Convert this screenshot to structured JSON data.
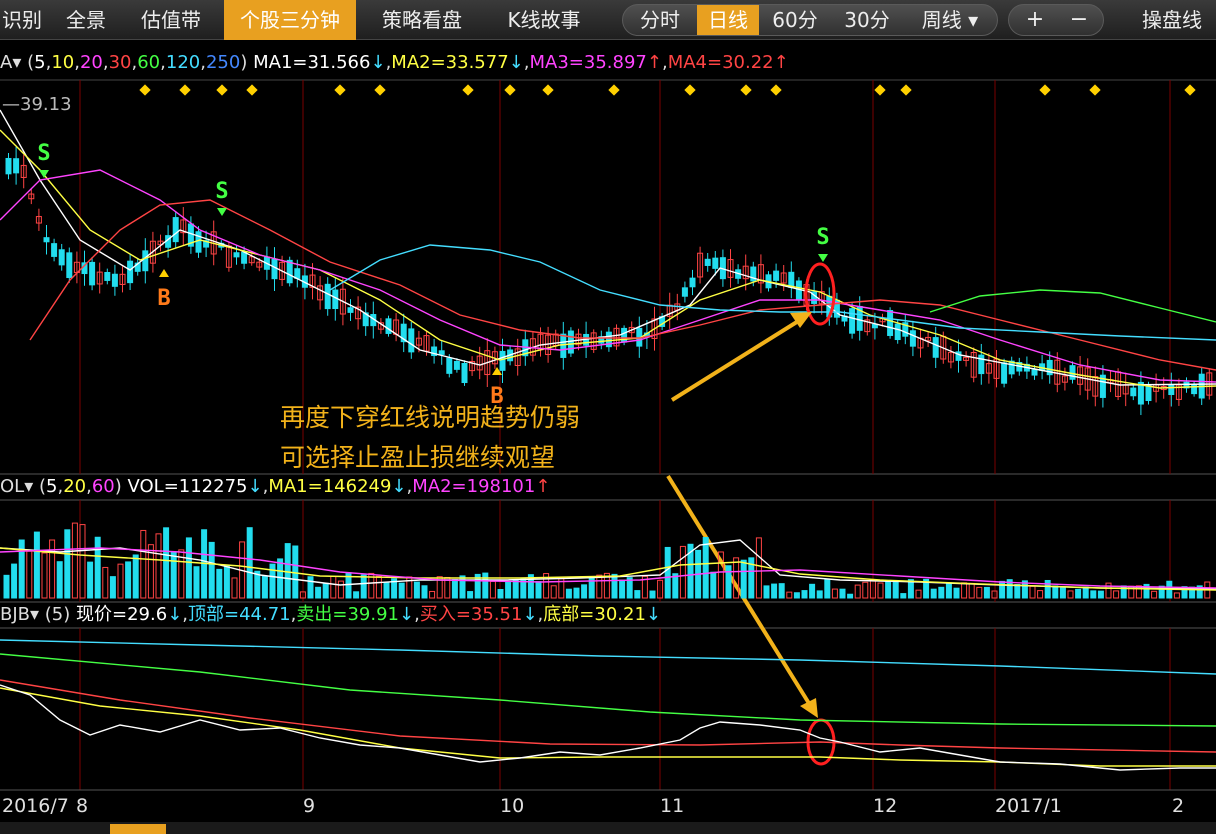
{
  "toolbar": {
    "tabs": [
      "识别",
      "全景",
      "估值带",
      "个股三分钟",
      "策略看盘",
      "K线故事"
    ],
    "active_tab": 3,
    "periods": [
      "分时",
      "日线",
      "60分",
      "30分",
      "周线 ▾"
    ],
    "active_period": 1,
    "zoom_in": "+",
    "zoom_out": "−",
    "right_label": "操盘线"
  },
  "panels": {
    "price_legend": {
      "prefix": "A▾",
      "params": [
        {
          "text": "(",
          "color": "#dddddd"
        },
        {
          "text": "5",
          "color": "#ffffff"
        },
        {
          "text": ",",
          "color": "#dddddd"
        },
        {
          "text": "10",
          "color": "#ffff44"
        },
        {
          "text": ",",
          "color": "#dddddd"
        },
        {
          "text": "20",
          "color": "#ff44ff"
        },
        {
          "text": ",",
          "color": "#dddddd"
        },
        {
          "text": "30",
          "color": "#ff4444"
        },
        {
          "text": ",",
          "color": "#dddddd"
        },
        {
          "text": "60",
          "color": "#44ff44"
        },
        {
          "text": ",",
          "color": "#dddddd"
        },
        {
          "text": "120",
          "color": "#44ddff"
        },
        {
          "text": ",",
          "color": "#dddddd"
        },
        {
          "text": "250",
          "color": "#4488ff"
        },
        {
          "text": ")",
          "color": "#dddddd"
        }
      ],
      "items": [
        {
          "text": "MA1=31.566",
          "arrow": "↓",
          "color": "#ffffff",
          "arrow_color": "#44ddff"
        },
        {
          "text": "MA2=33.577",
          "arrow": "↓",
          "color": "#ffff44",
          "arrow_color": "#44ddff"
        },
        {
          "text": "MA3=35.897",
          "arrow": "↑",
          "color": "#ff44ff",
          "arrow_color": "#ff4444"
        },
        {
          "text": "MA4=30.22",
          "arrow": "↑",
          "color": "#ff4444",
          "arrow_color": "#ff4444"
        }
      ],
      "high_label": "39.13"
    },
    "vol_legend": {
      "prefix": "OL▾",
      "params": [
        {
          "text": "(",
          "color": "#dddddd"
        },
        {
          "text": "5",
          "color": "#ffffff"
        },
        {
          "text": ",",
          "color": "#dddddd"
        },
        {
          "text": "20",
          "color": "#ffff44"
        },
        {
          "text": ",",
          "color": "#dddddd"
        },
        {
          "text": "60",
          "color": "#ff44ff"
        },
        {
          "text": ")",
          "color": "#dddddd"
        }
      ],
      "items": [
        {
          "text": "VOL=112275",
          "arrow": "↓",
          "color": "#ffffff",
          "arrow_color": "#44ddff"
        },
        {
          "text": "MA1=146249",
          "arrow": "↓",
          "color": "#ffff44",
          "arrow_color": "#44ddff"
        },
        {
          "text": "MA2=198101",
          "arrow": "↑",
          "color": "#ff44ff",
          "arrow_color": "#ff4444"
        }
      ]
    },
    "bjb_legend": {
      "prefix": "BJB▾",
      "params": [
        {
          "text": "(5)",
          "color": "#dddddd"
        }
      ],
      "items": [
        {
          "text": "现价=29.6",
          "arrow": "↓",
          "color": "#ffffff",
          "arrow_color": "#44ddff"
        },
        {
          "text": "顶部=44.71",
          "arrow": "",
          "color": "#44ddff",
          "arrow_color": "#44ddff"
        },
        {
          "text": "卖出=39.91",
          "arrow": "↓",
          "color": "#44ff44",
          "arrow_color": "#44ddff"
        },
        {
          "text": "买入=35.51",
          "arrow": "↓",
          "color": "#ff4444",
          "arrow_color": "#44ddff"
        },
        {
          "text": "底部=30.21",
          "arrow": "↓",
          "color": "#ffff44",
          "arrow_color": "#44ddff"
        }
      ]
    }
  },
  "annotation": {
    "line1": "再度下穿红线说明趋势仍弱",
    "line2": "可选择止盈止损继续观望"
  },
  "x_axis_labels": [
    "2016/7",
    "8",
    "9",
    "10",
    "11",
    "12",
    "2017/1",
    "2"
  ],
  "colors": {
    "up": "#ff4444",
    "down": "#22ddee",
    "grid": "#7a0000",
    "accent": "#e8a020",
    "signal_sell": "#44ff44",
    "signal_buy": "#ff7a1a"
  },
  "chart_data": {
    "type": "candlestick",
    "x_labels": [
      "2016/7",
      "8",
      "9",
      "10",
      "11",
      "12",
      "2017/1",
      "2"
    ],
    "signals": [
      {
        "label": "S",
        "type": "sell"
      },
      {
        "label": "S",
        "type": "sell"
      },
      {
        "label": "B",
        "type": "buy"
      },
      {
        "label": "B",
        "type": "buy"
      },
      {
        "label": "S",
        "type": "sell"
      }
    ]
  }
}
